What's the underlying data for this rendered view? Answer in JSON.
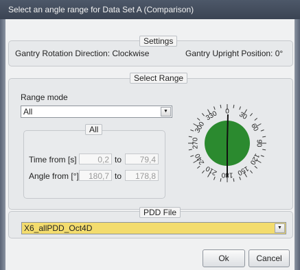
{
  "window": {
    "title": "Select an angle range for Data Set A (Comparison)"
  },
  "settings": {
    "group_label": "Settings",
    "rotation_direction": "Gantry Rotation Direction: Clockwise",
    "upright_position": "Gantry Upright Position: 0°"
  },
  "select_range": {
    "group_label": "Select Range",
    "range_mode_label": "Range mode",
    "range_mode_value": "All",
    "all_group_label": "All",
    "time_label": "Time from [s]",
    "time_from": "0,2",
    "time_to": "79,4",
    "angle_label": "Angle from [°]",
    "angle_from": "180,7",
    "angle_to": "178,8",
    "to_label": "to"
  },
  "dial": {
    "ticks": [
      "0",
      "30",
      "60",
      "90",
      "120",
      "150",
      "180",
      "210",
      "240",
      "270",
      "300",
      "330"
    ],
    "fill_color": "#2b8a2f",
    "selected_fraction": 0.995
  },
  "pdd": {
    "group_label": "PDD File",
    "value": "X6_allPDD_Oct4D",
    "highlight_color": "#f3dc6e"
  },
  "buttons": {
    "ok": "Ok",
    "cancel": "Cancel"
  }
}
